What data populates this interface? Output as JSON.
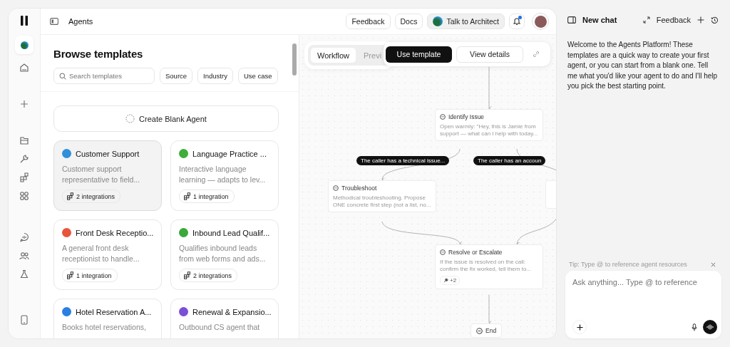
{
  "header": {
    "title": "Agents",
    "buttons": [
      "Feedback",
      "Docs"
    ],
    "architect_button": "Talk to Architect",
    "notification": true
  },
  "browse": {
    "title": "Browse templates",
    "search": {
      "placeholder": "Search templates"
    },
    "filters": [
      "Source",
      "Industry",
      "Use case"
    ],
    "blank_button": "Create Blank Agent"
  },
  "templates": [
    {
      "name": "Customer Support",
      "description": "Customer support representative to field...",
      "integrations": "2 integrations",
      "color": "#2f8fd8",
      "selected": true
    },
    {
      "name": "Language Practice ...",
      "description": "Interactive language learning — adapts to lev...",
      "integrations": "1 integration",
      "color": "#3fae3a",
      "selected": false
    },
    {
      "name": "Front Desk Receptio...",
      "description": "A general front desk receptionist to handle...",
      "integrations": "1 integration",
      "color": "#e8553a",
      "selected": false
    },
    {
      "name": "Inbound Lead Qualif...",
      "description": "Qualifies inbound leads from web forms and ads...",
      "integrations": "2 integrations",
      "color": "#3aa83a",
      "selected": false
    },
    {
      "name": "Hotel Reservation A...",
      "description": "Books hotel reservations,",
      "color": "#2a7fe0",
      "selected": false
    },
    {
      "name": "Renewal & Expansio...",
      "description": "Outbound CS agent that",
      "color": "#7b4fd8",
      "selected": false
    }
  ],
  "canvas": {
    "tabs": [
      {
        "label": "Workflow",
        "selected": true
      },
      {
        "label": "Previ",
        "selected": false
      }
    ],
    "actions": {
      "primary": "Use template",
      "secondary": "View details"
    },
    "nodes": [
      {
        "kind": "step",
        "title": "Identify Issue",
        "description": "Open warmly: \"Hey, this is Jamie from support — what can I help with today..."
      },
      {
        "kind": "step",
        "title": "Troubleshoot",
        "description": "Methodical troubleshooting. Propose ONE concrete first step (not a list, no..."
      },
      {
        "kind": "partial"
      },
      {
        "kind": "step",
        "title": "Resolve or Escalate",
        "description": "If the issue is resolved on the call: confirm the fix worked, tell them to...",
        "tools": "+2"
      },
      {
        "kind": "end",
        "title": "End"
      }
    ],
    "edge_labels": [
      "The caller has a technical issue...",
      "The caller has an accoun"
    ]
  },
  "chat": {
    "title": "New chat",
    "feedback": "Feedback",
    "message": "Welcome to the Agents Platform! These templates are a quick way to create your first agent, or you can start from a blank one. Tell me what you'd like your agent to do and I'll help you pick the best starting point.",
    "tip": "Tip: Type @ to reference agent resources",
    "input": {
      "placeholder": "Ask anything... Type @ to reference"
    }
  }
}
